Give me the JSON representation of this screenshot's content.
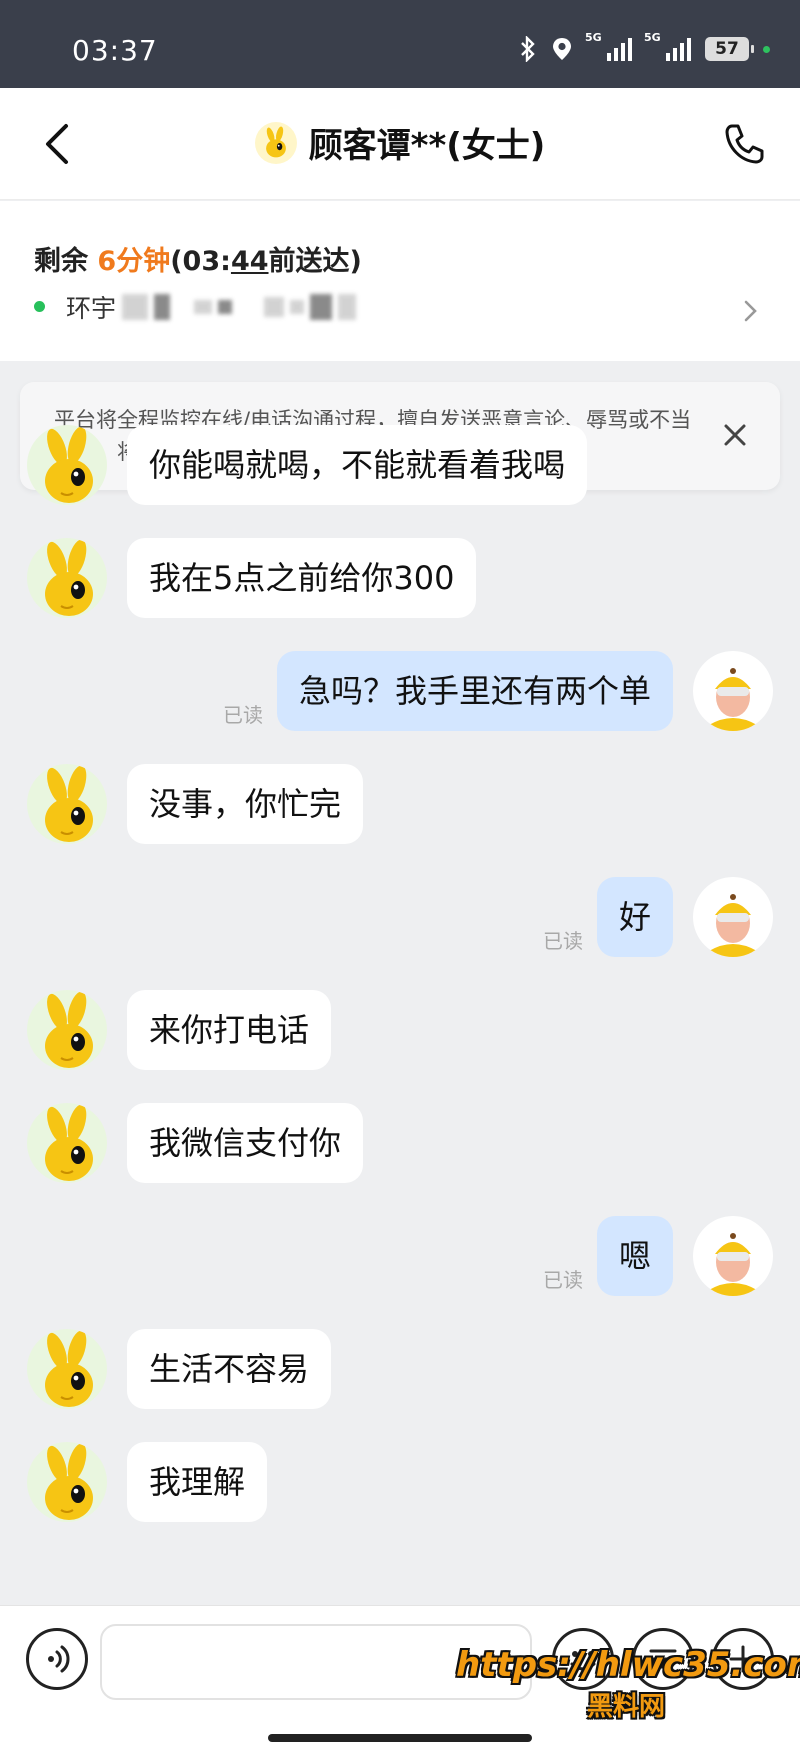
{
  "status_bar": {
    "time": "03:37",
    "network_1": "5G",
    "network_2": "5G",
    "battery": "57"
  },
  "header": {
    "title": "顾客谭**(女士)",
    "back_icon": "chevron-left-icon",
    "call_icon": "phone-icon"
  },
  "order": {
    "remaining_prefix": "剩余 ",
    "remaining_time": "6分钟",
    "deadline_open": "(0",
    "deadline_mid": "3:",
    "deadline_underlined": "44",
    "deadline_suffix": "前送达)",
    "address_visible": "环宇"
  },
  "notice": {
    "text": "平台将全程监控在线/电话沟通过程，擅自发送恶意言论、辱骂或不当内容，将被追责。"
  },
  "messages": [
    {
      "from": "customer",
      "text": "你能喝就喝，不能就看着我喝"
    },
    {
      "from": "customer",
      "text": "我在5点之前给你300"
    },
    {
      "from": "me",
      "text": "急吗？我手里还有两个单",
      "status": "已读"
    },
    {
      "from": "customer",
      "text": "没事，你忙完"
    },
    {
      "from": "me",
      "text": "好",
      "status": "已读"
    },
    {
      "from": "customer",
      "text": "来你打电话"
    },
    {
      "from": "customer",
      "text": "我微信支付你"
    },
    {
      "from": "me",
      "text": "嗯",
      "status": "已读"
    },
    {
      "from": "customer",
      "text": "生活不容易"
    },
    {
      "from": "customer",
      "text": "我理解"
    }
  ],
  "composer": {
    "input_value": "",
    "icons": [
      "voice-icon",
      "emoji-icon",
      "quick-reply-icon",
      "plus-icon"
    ]
  },
  "watermark": {
    "url": "https://hlwc35.com",
    "name": "黑料网"
  },
  "colors": {
    "accent_orange": "#f07a1d",
    "online_green": "#27c05b",
    "outgoing_bubble": "#d3e6ff",
    "chat_bg": "#eeeff1"
  }
}
